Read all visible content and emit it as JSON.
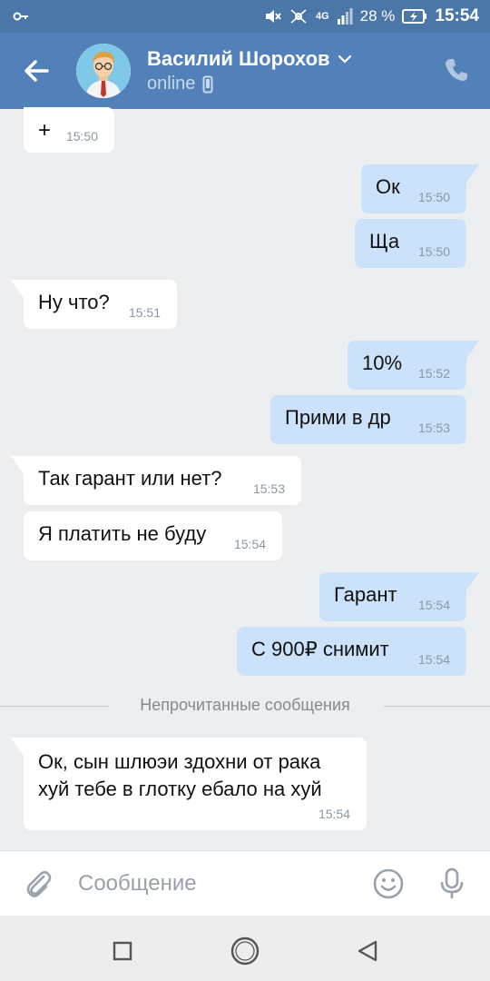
{
  "status_bar": {
    "battery": "28 %",
    "network": "4G",
    "time": "15:54"
  },
  "header": {
    "contact_name": "Василий Шорохов",
    "status": "online"
  },
  "messages": [
    {
      "dir": "in",
      "text": "+",
      "time": "15:50"
    },
    {
      "dir": "out",
      "text": "Ок",
      "time": "15:50"
    },
    {
      "dir": "out",
      "text": "Ща",
      "time": "15:50"
    },
    {
      "dir": "in",
      "text": "Ну что?",
      "time": "15:51"
    },
    {
      "dir": "out",
      "text": "10%",
      "time": "15:52"
    },
    {
      "dir": "out",
      "text": "Прими в др",
      "time": "15:53"
    },
    {
      "dir": "in",
      "text": "Так гарант или нет?",
      "time": "15:53"
    },
    {
      "dir": "in",
      "text": "Я платить не буду",
      "time": "15:54"
    },
    {
      "dir": "out",
      "text": "Гарант",
      "time": "15:54"
    },
    {
      "dir": "out",
      "text": "С 900₽ снимит",
      "time": "15:54"
    },
    {
      "dir": "in",
      "text": "Ок, сын шлюэи здохни от рака\nхуй тебе в глотку ебало на хуй",
      "time": "15:54"
    }
  ],
  "unread_divider": "Непрочитанные сообщения",
  "composer": {
    "placeholder": "Сообщение"
  },
  "colors": {
    "header": "#5181b8",
    "status_bar": "#4a76a8",
    "outgoing_bubble": "#cce2fb",
    "incoming_bubble": "#ffffff",
    "background": "#edeef0"
  }
}
